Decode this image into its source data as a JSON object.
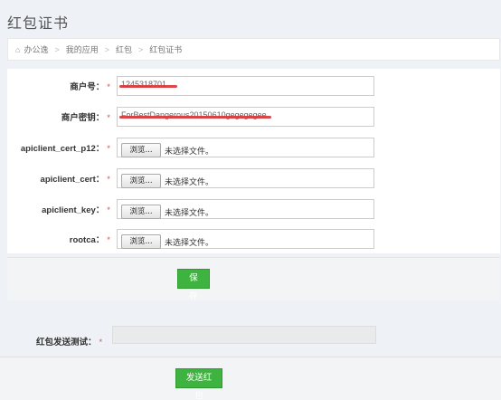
{
  "page": {
    "title": "红包证书"
  },
  "breadcrumb": {
    "items": [
      "办公逸",
      "我的应用",
      "红包",
      "红包证书"
    ]
  },
  "form": {
    "required_mark": "*",
    "merchant_id": {
      "label": "商户号：",
      "value": "1245318701"
    },
    "merchant_key": {
      "label": "商户密钥：",
      "value": "ForBestDangerous20150610gegegegee"
    },
    "files": [
      {
        "label": "apiclient_cert_p12：",
        "button": "浏览...",
        "status": "未选择文件。"
      },
      {
        "label": "apiclient_cert：",
        "button": "浏览...",
        "status": "未选择文件。"
      },
      {
        "label": "apiclient_key：",
        "button": "浏览...",
        "status": "未选择文件。"
      },
      {
        "label": "rootca：",
        "button": "浏览...",
        "status": "未选择文件。"
      }
    ]
  },
  "actions": {
    "save_label": "保存"
  },
  "test": {
    "label": "红包发送测试：",
    "send_label": "发送红包"
  },
  "colors": {
    "accent_green": "#3fb33f",
    "required_red": "#d9534f",
    "redaction_red": "#d9383a"
  }
}
